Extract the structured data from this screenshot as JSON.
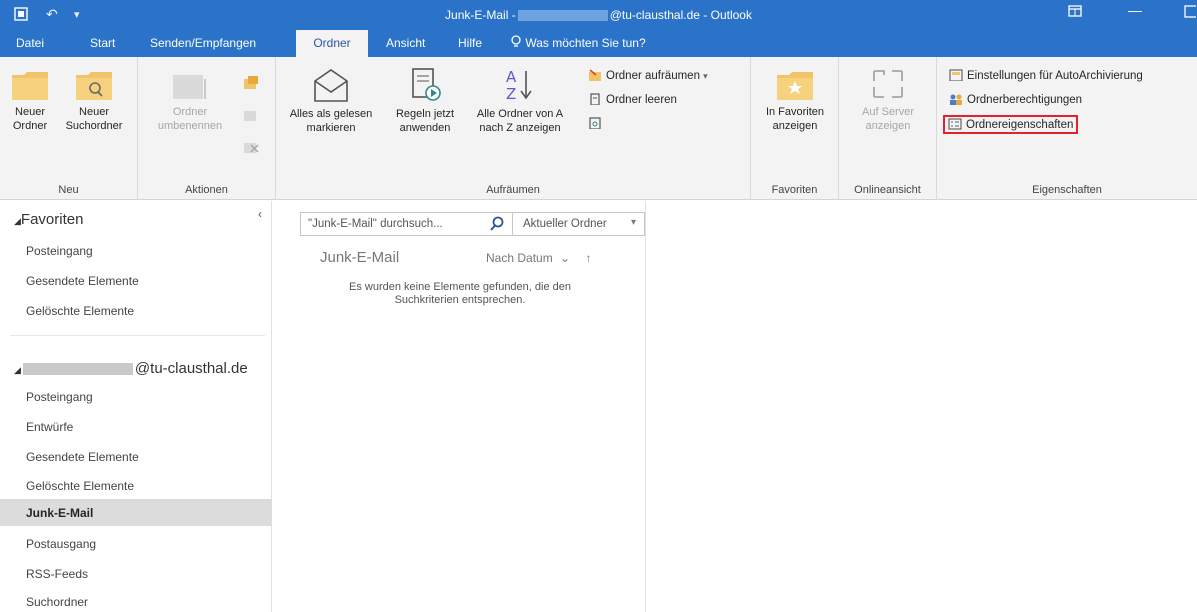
{
  "titlebar": {
    "title_prefix": "Junk-E-Mail -",
    "title_suffix": "@tu-clausthal.de - Outlook"
  },
  "tabs": [
    {
      "label": "Datei"
    },
    {
      "label": "Start"
    },
    {
      "label": "Senden/Empfangen"
    },
    {
      "label": "Ordner"
    },
    {
      "label": "Ansicht"
    },
    {
      "label": "Hilfe"
    }
  ],
  "tell_me": "Was möchten Sie tun?",
  "ribbon": {
    "neu": {
      "label": "Neu",
      "new_folder_1": "Neuer",
      "new_folder_2": "Ordner",
      "new_search_1": "Neuer",
      "new_search_2": "Suchordner"
    },
    "aktionen": {
      "label": "Aktionen",
      "rename_1": "Ordner",
      "rename_2": "umbenennen"
    },
    "aufraeumen": {
      "label": "Aufräumen",
      "mark_read_1": "Alles als gelesen",
      "mark_read_2": "markieren",
      "rules_1": "Regeln jetzt",
      "rules_2": "anwenden",
      "az_1": "Alle Ordner von A",
      "az_2": "nach Z anzeigen",
      "cleanup": "Ordner aufräumen",
      "empty": "Ordner leeren"
    },
    "favoriten": {
      "label": "Favoriten",
      "show_1": "In Favoriten",
      "show_2": "anzeigen"
    },
    "online": {
      "label": "Onlineansicht",
      "server_1": "Auf Server",
      "server_2": "anzeigen"
    },
    "eigenschaften": {
      "label": "Eigenschaften",
      "autoarchive": "Einstellungen für AutoArchivierung",
      "permissions": "Ordnerberechtigungen",
      "properties": "Ordnereigenschaften"
    }
  },
  "folderpane": {
    "favorites_header": "Favoriten",
    "favorites": [
      "Posteingang",
      "Gesendete Elemente",
      "Gelöschte Elemente"
    ],
    "account_suffix": "@tu-clausthal.de",
    "account_folders": [
      "Posteingang",
      "Entwürfe",
      "Gesendete Elemente",
      "Gelöschte Elemente",
      "Junk-E-Mail",
      "Postausgang",
      "RSS-Feeds",
      "Suchordner"
    ]
  },
  "msglist": {
    "search_placeholder": "\"Junk-E-Mail\" durchsuch...",
    "scope": "Aktueller Ordner",
    "title": "Junk-E-Mail",
    "sort": "Nach Datum",
    "empty_1": "Es wurden keine Elemente gefunden, die den",
    "empty_2": "Suchkriterien entsprechen."
  },
  "colors": {
    "accent": "#2b73c8",
    "highlight_box": "#e8202a",
    "selected_row": "#dcdcdc"
  }
}
